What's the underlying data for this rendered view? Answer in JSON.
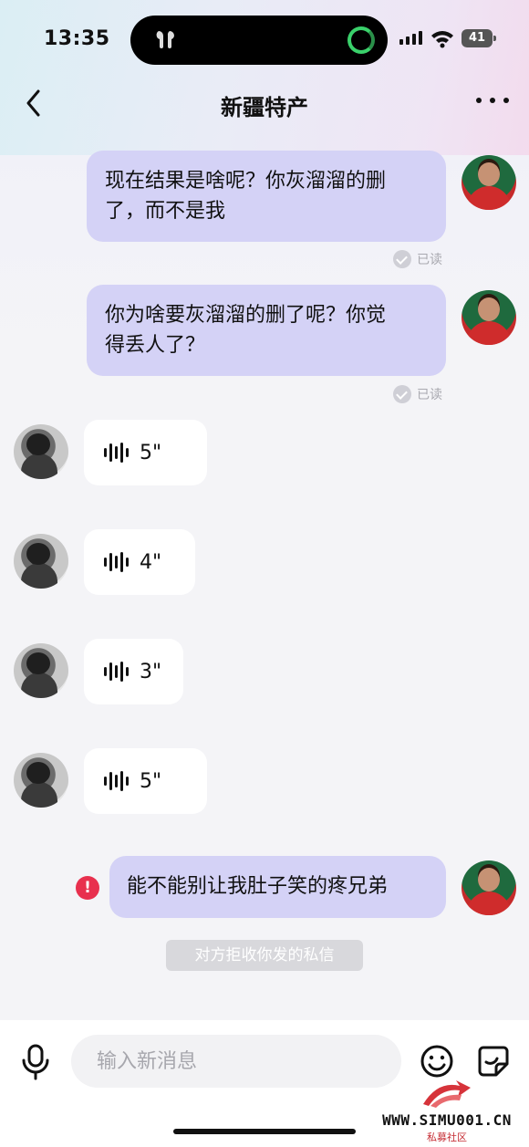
{
  "status_bar": {
    "time": "13:35",
    "battery": "41"
  },
  "nav": {
    "title": "新疆特产",
    "back_icon": "chevron-left-icon",
    "more_icon": "more-dots-icon"
  },
  "messages": [
    {
      "type": "sent_text",
      "text_line1": "现在结果是啥呢？你灰溜溜的删",
      "text_line2": "了，而不是我",
      "status": "已读"
    },
    {
      "type": "sent_text",
      "text_line1": "你为啥要灰溜溜的删了呢？你觉",
      "text_line2": "得丢人了？",
      "status": "已读"
    },
    {
      "type": "received_voice",
      "duration": "5\""
    },
    {
      "type": "received_voice",
      "duration": "4\""
    },
    {
      "type": "received_voice",
      "duration": "3\""
    },
    {
      "type": "received_voice",
      "duration": "5\""
    },
    {
      "type": "sent_text_failed",
      "text": "能不能别让我肚子笑的疼兄弟",
      "error_mark": "!"
    }
  ],
  "system_notice": "对方拒收你发的私信",
  "input": {
    "placeholder": "输入新消息"
  },
  "watermark": {
    "text": "WWW.SIMU001.CN",
    "sub": "私募社区"
  },
  "colors": {
    "sent_bubble": "#d4d2f6",
    "received_bubble": "#ffffff",
    "error": "#e8304e",
    "read_status": "#a9a9b0"
  }
}
